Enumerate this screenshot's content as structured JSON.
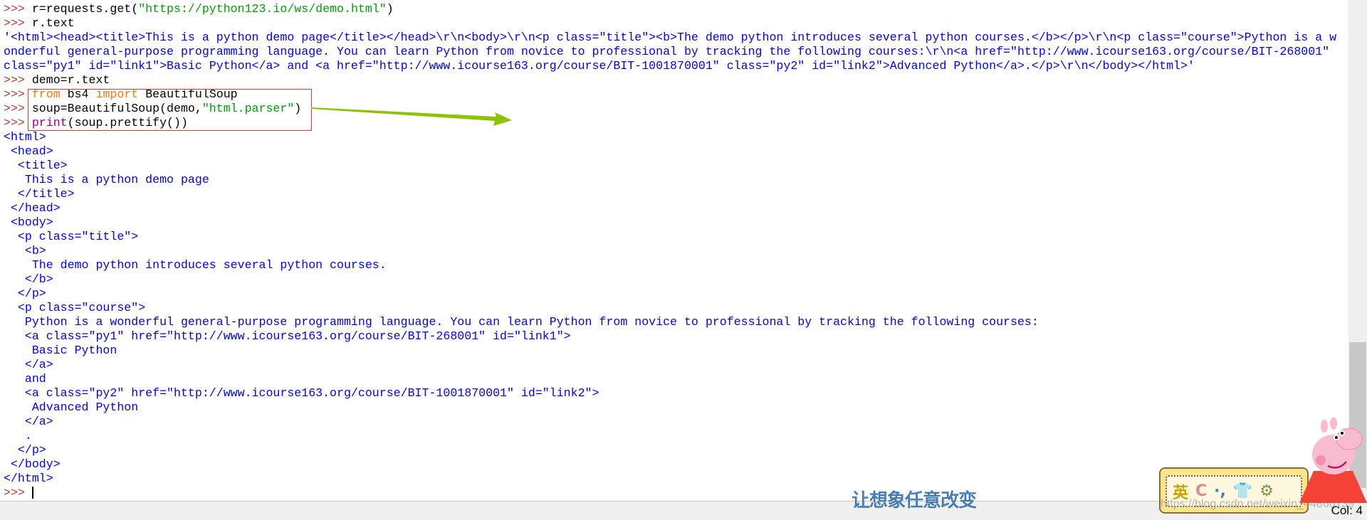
{
  "console": {
    "lines": [
      [
        [
          ">>> ",
          "prompt"
        ],
        [
          "r=requests.get(",
          ""
        ],
        [
          "\"https://python123.io/ws/demo.html\"",
          "str"
        ],
        [
          ")",
          ""
        ]
      ],
      [
        [
          ">>> ",
          "prompt"
        ],
        [
          "r.text",
          ""
        ]
      ],
      [
        [
          "'<html><head><title>This is a python demo page</title></head>\\r\\n<body>\\r\\n<p class=\"title\"><b>The demo python introduces several python courses.</b></p>\\r\\n<p class=\"course\">Python is a w",
          "out"
        ]
      ],
      [
        [
          "onderful general-purpose programming language. You can learn Python from novice to professional by tracking the following courses:\\r\\n<a href=\"http://www.icourse163.org/course/BIT-268001\"",
          "out"
        ]
      ],
      [
        [
          "class=\"py1\" id=\"link1\">Basic Python</a> and <a href=\"http://www.icourse163.org/course/BIT-1001870001\" class=\"py2\" id=\"link2\">Advanced Python</a>.</p>\\r\\n</body></html>'",
          "out"
        ]
      ],
      [
        [
          ">>> ",
          "prompt"
        ],
        [
          "demo=r.text",
          ""
        ]
      ],
      [
        [
          ">>> ",
          "prompt"
        ],
        [
          "from",
          "kw"
        ],
        [
          " bs4 ",
          ""
        ],
        [
          "import",
          "kw"
        ],
        [
          " BeautifulSoup",
          ""
        ]
      ],
      [
        [
          ">>> ",
          "prompt"
        ],
        [
          "soup=BeautifulSoup(demo,",
          ""
        ],
        [
          "\"html.parser\"",
          "str"
        ],
        [
          ")",
          ""
        ]
      ],
      [
        [
          ">>> ",
          "prompt"
        ],
        [
          "print",
          "bi"
        ],
        [
          "(soup.prettify())",
          ""
        ]
      ],
      [
        [
          "<html>",
          "out"
        ]
      ],
      [
        [
          " <head>",
          "out"
        ]
      ],
      [
        [
          "  <title>",
          "out"
        ]
      ],
      [
        [
          "   This is a python demo page",
          "out"
        ]
      ],
      [
        [
          "  </title>",
          "out"
        ]
      ],
      [
        [
          " </head>",
          "out"
        ]
      ],
      [
        [
          " <body>",
          "out"
        ]
      ],
      [
        [
          "  <p class=\"title\">",
          "out"
        ]
      ],
      [
        [
          "   <b>",
          "out"
        ]
      ],
      [
        [
          "    The demo python introduces several python courses.",
          "out"
        ]
      ],
      [
        [
          "   </b>",
          "out"
        ]
      ],
      [
        [
          "  </p>",
          "out"
        ]
      ],
      [
        [
          "  <p class=\"course\">",
          "out"
        ]
      ],
      [
        [
          "   Python is a wonderful general-purpose programming language. You can learn Python from novice to professional by tracking the following courses:",
          "out"
        ]
      ],
      [
        [
          "   <a class=\"py1\" href=\"http://www.icourse163.org/course/BIT-268001\" id=\"link1\">",
          "out"
        ]
      ],
      [
        [
          "    Basic Python",
          "out"
        ]
      ],
      [
        [
          "   </a>",
          "out"
        ]
      ],
      [
        [
          "   and",
          "out"
        ]
      ],
      [
        [
          "   <a class=\"py2\" href=\"http://www.icourse163.org/course/BIT-1001870001\" id=\"link2\">",
          "out"
        ]
      ],
      [
        [
          "    Advanced Python",
          "out"
        ]
      ],
      [
        [
          "   </a>",
          "out"
        ]
      ],
      [
        [
          "   .",
          "out"
        ]
      ],
      [
        [
          "  </p>",
          "out"
        ]
      ],
      [
        [
          " </body>",
          "out"
        ]
      ],
      [
        [
          "</html>",
          "out"
        ]
      ],
      [
        [
          ">>> ",
          "prompt"
        ]
      ]
    ]
  },
  "status": {
    "col": "Col: 4"
  },
  "overlay": {
    "ime_text": "让想象任意改变",
    "ime_bar_items": [
      "英",
      "C",
      "·,",
      "👕",
      "⚙"
    ],
    "watermark": "https://blog.csdn.net/weixin_44866139"
  },
  "colors": {
    "prompt": "#c0392b",
    "output": "#0000ff",
    "string": "#00a000",
    "keyword": "#ff7700",
    "builtin": "#900090",
    "highlight_box": "#e53935",
    "arrow": "#8bc400"
  }
}
